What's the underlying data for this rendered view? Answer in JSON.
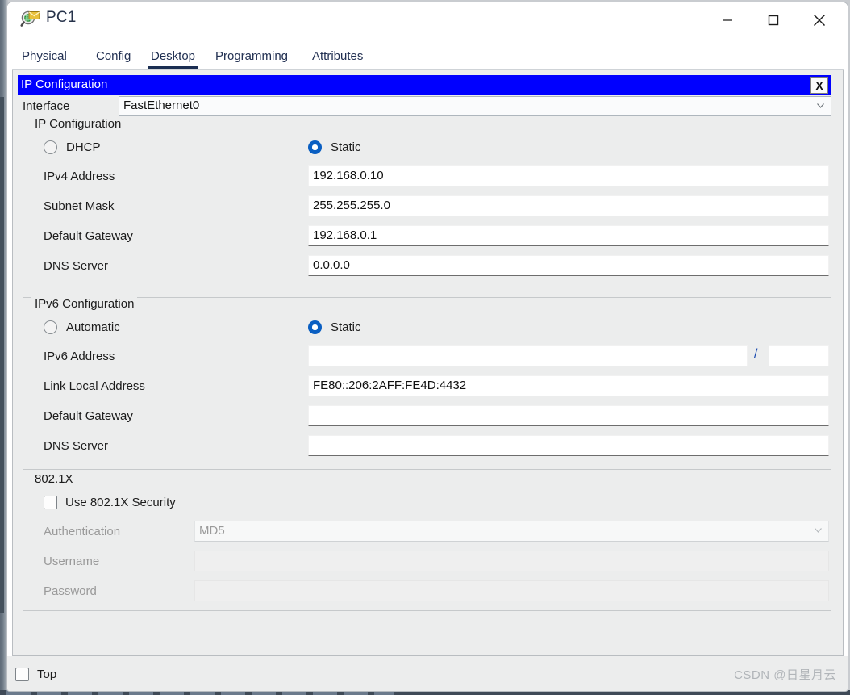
{
  "window": {
    "title": "PC1",
    "icon": "packet-tracer-inspect-icon",
    "controls": {
      "minimize": "—",
      "maximize": "☐",
      "close": "✕"
    }
  },
  "tabs": [
    {
      "label": "Physical",
      "active": false
    },
    {
      "label": "Config",
      "active": false
    },
    {
      "label": "Desktop",
      "active": true
    },
    {
      "label": "Programming",
      "active": false
    },
    {
      "label": "Attributes",
      "active": false
    }
  ],
  "dialog": {
    "title": "IP Configuration",
    "close_label": "X"
  },
  "interface": {
    "label": "Interface",
    "value": "FastEthernet0",
    "options": [
      "FastEthernet0"
    ]
  },
  "ipv4": {
    "legend": "IP Configuration",
    "mode": {
      "dhcp_label": "DHCP",
      "static_label": "Static",
      "selected": "Static"
    },
    "fields": [
      {
        "label": "IPv4 Address",
        "value": "192.168.0.10"
      },
      {
        "label": "Subnet Mask",
        "value": "255.255.255.0"
      },
      {
        "label": "Default Gateway",
        "value": "192.168.0.1"
      },
      {
        "label": "DNS Server",
        "value": "0.0.0.0"
      }
    ]
  },
  "ipv6": {
    "legend": "IPv6 Configuration",
    "mode": {
      "automatic_label": "Automatic",
      "static_label": "Static",
      "selected": "Static"
    },
    "address_label": "IPv6 Address",
    "address_value": "",
    "prefix_separator": "/",
    "prefix_value": "",
    "fields": [
      {
        "label": "Link Local Address",
        "value": "FE80::206:2AFF:FE4D:4432"
      },
      {
        "label": "Default Gateway",
        "value": ""
      },
      {
        "label": "DNS Server",
        "value": ""
      }
    ]
  },
  "dot1x": {
    "legend": "802.1X",
    "use_security_label": "Use 802.1X Security",
    "use_security_checked": false,
    "authentication": {
      "label": "Authentication",
      "value": "MD5",
      "options": [
        "MD5"
      ],
      "disabled": true
    },
    "username": {
      "label": "Username",
      "value": "",
      "disabled": true
    },
    "password": {
      "label": "Password",
      "value": "",
      "disabled": true
    }
  },
  "footer": {
    "top_label": "Top",
    "top_checked": false,
    "watermark": "CSDN @日星月云"
  },
  "colors": {
    "dialog_title_bg": "#0000ff",
    "radio_accent": "#0a5fc2",
    "tab_active_underline": "#1b2e52",
    "panel_bg": "#eceded"
  }
}
